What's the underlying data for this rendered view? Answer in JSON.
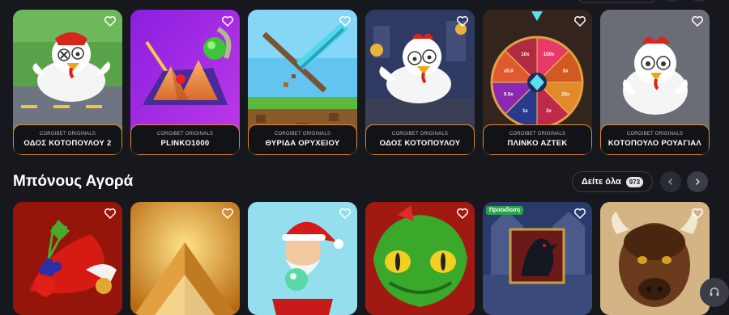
{
  "originals": [
    {
      "provider": "CORGIBET ORIGINALS",
      "name": "ΟΔΟΣ ΚΟΤΟΠΟΥΛΟΥ 2"
    },
    {
      "provider": "CORGIBET ORIGINALS",
      "name": "PLINKO1000"
    },
    {
      "provider": "CORGIBET ORIGINALS",
      "name": "ΘΥΡΙΔΑ ΟΡΥΧΕΙΟΥ"
    },
    {
      "provider": "CORGIBET ORIGINALS",
      "name": "ΟΔΟΣ ΚΟΤΟΠΟΥΛΟΥ"
    },
    {
      "provider": "CORGIBET ORIGINALS",
      "name": "ΠΛΙΝΚΟ ΑΖΤΕΚ"
    },
    {
      "provider": "CORGIBET ORIGINALS",
      "name": "ΚΟΤΟΠΟΥΛΟ ΡΟΥΑΓΙΑΛ"
    }
  ],
  "wheel": {
    "segments": [
      "100x",
      "5x",
      "20x",
      "2x",
      "1x",
      "0.5x",
      "x5.0",
      "10x"
    ]
  },
  "bonus_section": {
    "title": "Μπόνους Αγορά",
    "see_all_label": "Δείτε όλα",
    "count": "973",
    "promo_badge": "Προέκδοση"
  },
  "colors": {
    "accent": "#e08a2c",
    "background": "#17181d",
    "promo": "#2aa14a"
  },
  "icons": [
    "heart-icon",
    "chevron-left-icon",
    "chevron-right-icon",
    "headset-icon"
  ]
}
